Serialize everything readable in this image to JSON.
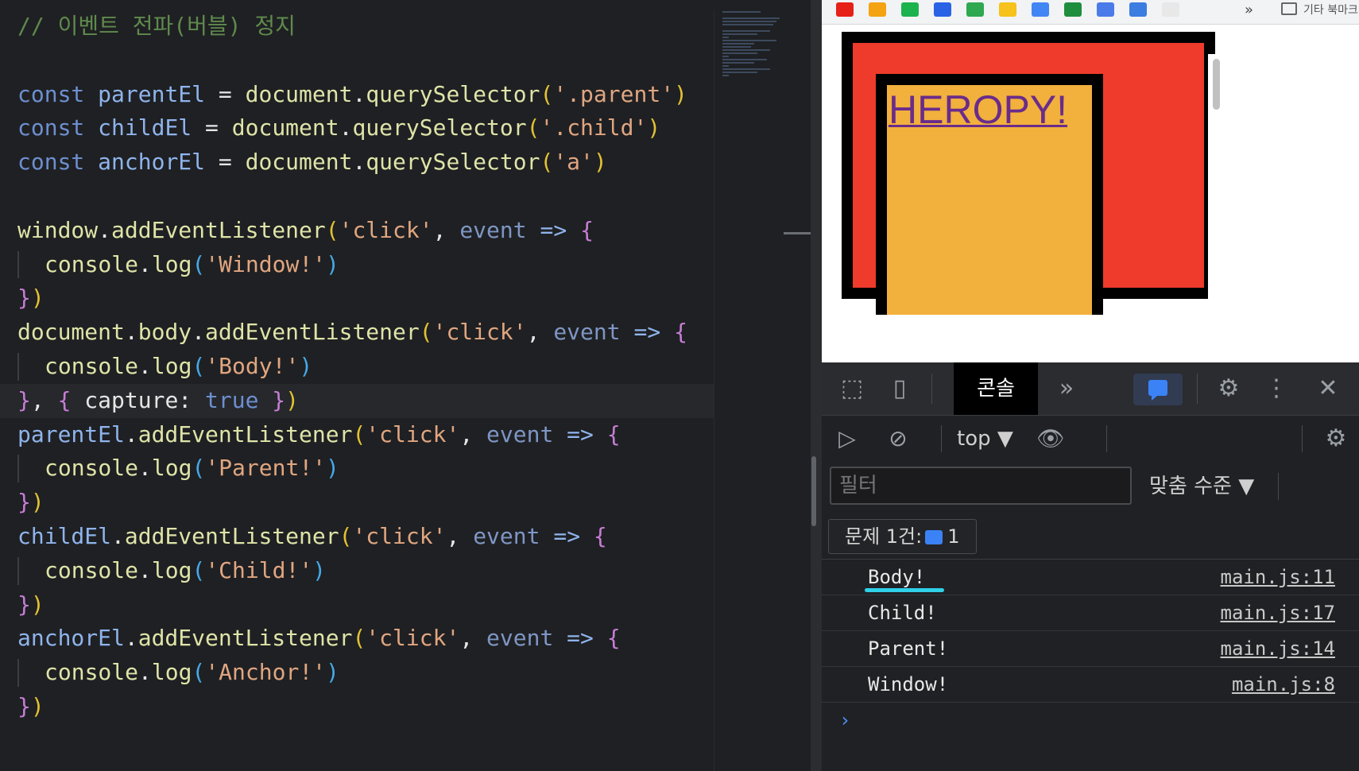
{
  "editor": {
    "lines": [
      {
        "tokens": [
          {
            "t": "// 이벤트 전파(버블) 정지",
            "c": "c-com"
          }
        ]
      },
      {
        "tokens": []
      },
      {
        "tokens": [
          {
            "t": "const ",
            "c": "c-kw"
          },
          {
            "t": "parentEl",
            "c": "c-var"
          },
          {
            "t": " = ",
            "c": "c-plain"
          },
          {
            "t": "document",
            "c": "c-fn"
          },
          {
            "t": ".",
            "c": "c-plain"
          },
          {
            "t": "querySelector",
            "c": "c-fn"
          },
          {
            "t": "(",
            "c": "c-brk1"
          },
          {
            "t": "'.parent'",
            "c": "c-str"
          },
          {
            "t": ")",
            "c": "c-brk1"
          }
        ]
      },
      {
        "tokens": [
          {
            "t": "const ",
            "c": "c-kw"
          },
          {
            "t": "childEl",
            "c": "c-var"
          },
          {
            "t": " = ",
            "c": "c-plain"
          },
          {
            "t": "document",
            "c": "c-fn"
          },
          {
            "t": ".",
            "c": "c-plain"
          },
          {
            "t": "querySelector",
            "c": "c-fn"
          },
          {
            "t": "(",
            "c": "c-brk1"
          },
          {
            "t": "'.child'",
            "c": "c-str"
          },
          {
            "t": ")",
            "c": "c-brk1"
          }
        ]
      },
      {
        "tokens": [
          {
            "t": "const ",
            "c": "c-kw"
          },
          {
            "t": "anchorEl",
            "c": "c-var"
          },
          {
            "t": " = ",
            "c": "c-plain"
          },
          {
            "t": "document",
            "c": "c-fn"
          },
          {
            "t": ".",
            "c": "c-plain"
          },
          {
            "t": "querySelector",
            "c": "c-fn"
          },
          {
            "t": "(",
            "c": "c-brk1"
          },
          {
            "t": "'a'",
            "c": "c-str"
          },
          {
            "t": ")",
            "c": "c-brk1"
          }
        ]
      },
      {
        "tokens": []
      },
      {
        "tokens": [
          {
            "t": "window",
            "c": "c-fn"
          },
          {
            "t": ".",
            "c": "c-plain"
          },
          {
            "t": "addEventListener",
            "c": "c-fn"
          },
          {
            "t": "(",
            "c": "c-brk1"
          },
          {
            "t": "'click'",
            "c": "c-str"
          },
          {
            "t": ", ",
            "c": "c-plain"
          },
          {
            "t": "event",
            "c": "c-prm"
          },
          {
            "t": " => ",
            "c": "c-op"
          },
          {
            "t": "{",
            "c": "c-brk2"
          }
        ]
      },
      {
        "indent": true,
        "tokens": [
          {
            "t": "console",
            "c": "c-fn"
          },
          {
            "t": ".",
            "c": "c-plain"
          },
          {
            "t": "log",
            "c": "c-fn"
          },
          {
            "t": "(",
            "c": "c-brk3"
          },
          {
            "t": "'Window!'",
            "c": "c-str"
          },
          {
            "t": ")",
            "c": "c-brk3"
          }
        ]
      },
      {
        "tokens": [
          {
            "t": "}",
            "c": "c-brk2"
          },
          {
            "t": ")",
            "c": "c-brk1"
          }
        ]
      },
      {
        "tokens": [
          {
            "t": "document",
            "c": "c-fn"
          },
          {
            "t": ".",
            "c": "c-plain"
          },
          {
            "t": "body",
            "c": "c-fn"
          },
          {
            "t": ".",
            "c": "c-plain"
          },
          {
            "t": "addEventListener",
            "c": "c-fn"
          },
          {
            "t": "(",
            "c": "c-brk1"
          },
          {
            "t": "'click'",
            "c": "c-str"
          },
          {
            "t": ", ",
            "c": "c-plain"
          },
          {
            "t": "event",
            "c": "c-prm"
          },
          {
            "t": " => ",
            "c": "c-op"
          },
          {
            "t": "{",
            "c": "c-brk2"
          }
        ]
      },
      {
        "indent": true,
        "tokens": [
          {
            "t": "console",
            "c": "c-fn"
          },
          {
            "t": ".",
            "c": "c-plain"
          },
          {
            "t": "log",
            "c": "c-fn"
          },
          {
            "t": "(",
            "c": "c-brk3"
          },
          {
            "t": "'Body!'",
            "c": "c-str"
          },
          {
            "t": ")",
            "c": "c-brk3"
          }
        ]
      },
      {
        "current": true,
        "tokens": [
          {
            "t": "}",
            "c": "c-brk2"
          },
          {
            "t": ", ",
            "c": "c-plain"
          },
          {
            "t": "{",
            "c": "c-brk2"
          },
          {
            "t": " capture: ",
            "c": "c-plain"
          },
          {
            "t": "true",
            "c": "c-kw"
          },
          {
            "t": " }",
            "c": "c-brk2"
          },
          {
            "t": ")",
            "c": "c-brk1"
          }
        ]
      },
      {
        "tokens": [
          {
            "t": "parentEl",
            "c": "c-var"
          },
          {
            "t": ".",
            "c": "c-plain"
          },
          {
            "t": "addEventListener",
            "c": "c-fn"
          },
          {
            "t": "(",
            "c": "c-brk1"
          },
          {
            "t": "'click'",
            "c": "c-str"
          },
          {
            "t": ", ",
            "c": "c-plain"
          },
          {
            "t": "event",
            "c": "c-prm"
          },
          {
            "t": " => ",
            "c": "c-op"
          },
          {
            "t": "{",
            "c": "c-brk2"
          }
        ]
      },
      {
        "indent": true,
        "tokens": [
          {
            "t": "console",
            "c": "c-fn"
          },
          {
            "t": ".",
            "c": "c-plain"
          },
          {
            "t": "log",
            "c": "c-fn"
          },
          {
            "t": "(",
            "c": "c-brk3"
          },
          {
            "t": "'Parent!'",
            "c": "c-str"
          },
          {
            "t": ")",
            "c": "c-brk3"
          }
        ]
      },
      {
        "tokens": [
          {
            "t": "}",
            "c": "c-brk2"
          },
          {
            "t": ")",
            "c": "c-brk1"
          }
        ]
      },
      {
        "tokens": [
          {
            "t": "childEl",
            "c": "c-var"
          },
          {
            "t": ".",
            "c": "c-plain"
          },
          {
            "t": "addEventListener",
            "c": "c-fn"
          },
          {
            "t": "(",
            "c": "c-brk1"
          },
          {
            "t": "'click'",
            "c": "c-str"
          },
          {
            "t": ", ",
            "c": "c-plain"
          },
          {
            "t": "event",
            "c": "c-prm"
          },
          {
            "t": " => ",
            "c": "c-op"
          },
          {
            "t": "{",
            "c": "c-brk2"
          }
        ]
      },
      {
        "indent": true,
        "tokens": [
          {
            "t": "console",
            "c": "c-fn"
          },
          {
            "t": ".",
            "c": "c-plain"
          },
          {
            "t": "log",
            "c": "c-fn"
          },
          {
            "t": "(",
            "c": "c-brk3"
          },
          {
            "t": "'Child!'",
            "c": "c-str"
          },
          {
            "t": ")",
            "c": "c-brk3"
          }
        ]
      },
      {
        "tokens": [
          {
            "t": "}",
            "c": "c-brk2"
          },
          {
            "t": ")",
            "c": "c-brk1"
          }
        ]
      },
      {
        "tokens": [
          {
            "t": "anchorEl",
            "c": "c-var"
          },
          {
            "t": ".",
            "c": "c-plain"
          },
          {
            "t": "addEventListener",
            "c": "c-fn"
          },
          {
            "t": "(",
            "c": "c-brk1"
          },
          {
            "t": "'click'",
            "c": "c-str"
          },
          {
            "t": ", ",
            "c": "c-plain"
          },
          {
            "t": "event",
            "c": "c-prm"
          },
          {
            "t": " => ",
            "c": "c-op"
          },
          {
            "t": "{",
            "c": "c-brk2"
          }
        ]
      },
      {
        "indent": true,
        "tokens": [
          {
            "t": "console",
            "c": "c-fn"
          },
          {
            "t": ".",
            "c": "c-plain"
          },
          {
            "t": "log",
            "c": "c-fn"
          },
          {
            "t": "(",
            "c": "c-brk3"
          },
          {
            "t": "'Anchor!'",
            "c": "c-str"
          },
          {
            "t": ")",
            "c": "c-brk3"
          }
        ]
      },
      {
        "tokens": [
          {
            "t": "}",
            "c": "c-brk2"
          },
          {
            "t": ")",
            "c": "c-brk1"
          }
        ]
      }
    ]
  },
  "browser": {
    "bookmarks": [
      {
        "icon": "youtube-icon",
        "color": "#e62117"
      },
      {
        "icon": "bookmark-d-icon",
        "color": "#f4a312"
      },
      {
        "icon": "bookmark-n-icon",
        "color": "#1bb34d"
      },
      {
        "icon": "dropbox-icon",
        "color": "#2a62e6"
      },
      {
        "icon": "drive-icon",
        "color": "#2fa84f"
      },
      {
        "icon": "keep-icon",
        "color": "#f6c21b"
      },
      {
        "icon": "google-icon",
        "color": "#4285f4"
      },
      {
        "icon": "sheets-icon",
        "color": "#1e8e3e"
      },
      {
        "icon": "docs-icon",
        "color": "#4a7be8"
      },
      {
        "icon": "calendar-icon",
        "color": "#3b7de0"
      },
      {
        "icon": "notes-icon",
        "color": "#e8e8e8"
      }
    ],
    "more_bookmarks": "»",
    "other_bookmarks": "기타 북마크",
    "demo_link_text": "HEROPY!",
    "demo_colors": {
      "parent": "#ee3b2c",
      "child": "#f2b03d",
      "border": "#000000"
    }
  },
  "devtools": {
    "console_tab": "콘솔",
    "more_tabs": "»",
    "context": "top ▼",
    "filter_placeholder": "필터",
    "level_select": "맞춤 수준 ▼",
    "issues_label": "문제 1건:",
    "issues_count": "1",
    "logs": [
      {
        "message": "Body!",
        "source": "main.js:11",
        "highlighted": true
      },
      {
        "message": "Child!",
        "source": "main.js:17"
      },
      {
        "message": "Parent!",
        "source": "main.js:14"
      },
      {
        "message": "Window!",
        "source": "main.js:8"
      }
    ],
    "prompt": "›"
  }
}
